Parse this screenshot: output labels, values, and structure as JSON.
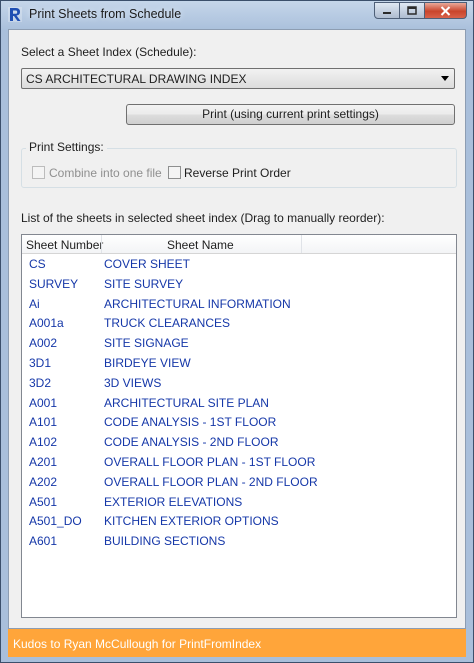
{
  "window": {
    "title": "Print Sheets from Schedule",
    "icon": "revit-logo-icon"
  },
  "main": {
    "sheet_index_label": "Select a Sheet Index (Schedule):",
    "sheet_index_value": "CS ARCHITECTURAL DRAWING INDEX",
    "print_button_label": "Print (using current print settings)",
    "print_settings": {
      "title": "Print Settings:",
      "combine_label": "Combine into one file",
      "combine_checked": false,
      "combine_enabled": false,
      "reverse_label": "Reverse Print Order",
      "reverse_checked": false
    },
    "list_label": "List of the sheets in selected sheet index (Drag to manually reorder):",
    "columns": [
      "Sheet Number",
      "Sheet Name"
    ],
    "sheets": [
      {
        "number": "CS",
        "name": "COVER SHEET"
      },
      {
        "number": "SURVEY",
        "name": "SITE SURVEY"
      },
      {
        "number": "Ai",
        "name": "ARCHITECTURAL INFORMATION"
      },
      {
        "number": "A001a",
        "name": "TRUCK CLEARANCES"
      },
      {
        "number": "A002",
        "name": "SITE SIGNAGE"
      },
      {
        "number": "3D1",
        "name": "BIRDEYE VIEW"
      },
      {
        "number": "3D2",
        "name": "3D VIEWS"
      },
      {
        "number": "A001",
        "name": "ARCHITECTURAL SITE PLAN"
      },
      {
        "number": "A101",
        "name": "CODE ANALYSIS - 1ST FLOOR"
      },
      {
        "number": "A102",
        "name": "CODE ANALYSIS - 2ND FLOOR"
      },
      {
        "number": "A201",
        "name": "OVERALL FLOOR PLAN - 1ST FLOOR"
      },
      {
        "number": "A202",
        "name": "OVERALL FLOOR PLAN - 2ND FLOOR"
      },
      {
        "number": "A501",
        "name": "EXTERIOR ELEVATIONS"
      },
      {
        "number": "A501_DO",
        "name": "KITCHEN EXTERIOR OPTIONS"
      },
      {
        "number": "A601",
        "name": "BUILDING SECTIONS"
      }
    ]
  },
  "footer": {
    "text": "Kudos to Ryan McCullough for PrintFromIndex"
  },
  "colors": {
    "footer_bg": "#ffa53a",
    "list_text": "#1537a8"
  }
}
